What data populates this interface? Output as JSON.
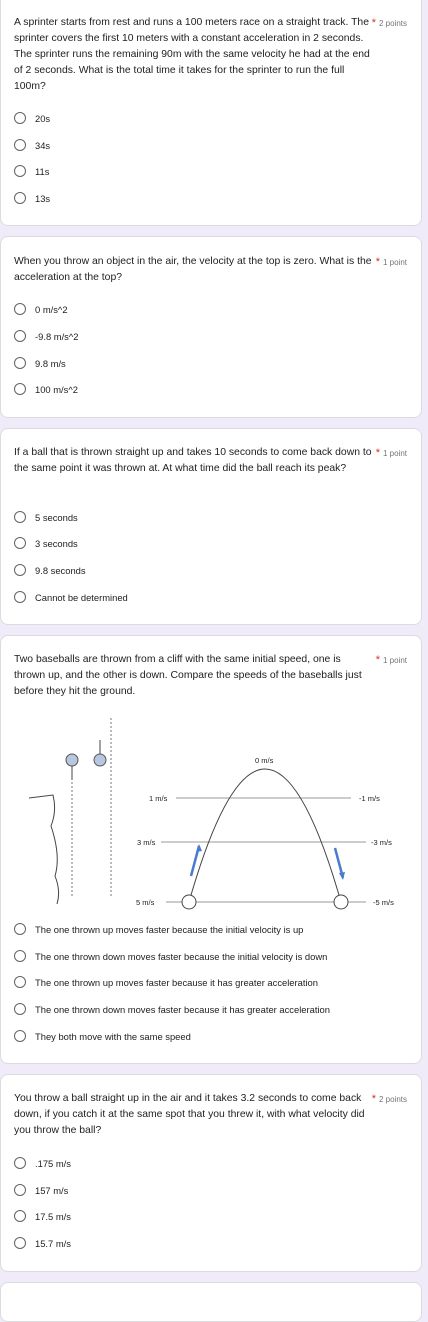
{
  "questions": [
    {
      "text": "A sprinter starts from rest and runs a 100 meters race on a straight track. The sprinter covers the first 10 meters with a constant acceleration in 2 seconds. The sprinter runs the remaining 90m with the same velocity he had at the end of 2 seconds. What is the total time it takes for the sprinter to run the full 100m?",
      "points": "2 points",
      "options": [
        "20s",
        "34s",
        "11s",
        "13s"
      ]
    },
    {
      "text": "When you throw an object in the air, the velocity at the top is zero. What is the acceleration at the top?",
      "points": "1 point",
      "options": [
        "0 m/s^2",
        "-9.8 m/s^2",
        "9.8 m/s",
        "100 m/s^2"
      ]
    },
    {
      "text": "If a ball that is thrown straight up and takes 10 seconds to come back down to the same point it was thrown at. At what time did the ball reach its peak?",
      "points": "1 point",
      "options": [
        "5 seconds",
        "3 seconds",
        "9.8 seconds",
        "Cannot be determined"
      ]
    },
    {
      "text": "Two baseballs are thrown from a cliff with the same initial speed, one is thrown up, and the other is down. Compare the speeds of the baseballs just before they hit the ground.",
      "points": "1 point",
      "figure": {
        "top_label": "0 m/s",
        "left_labels": [
          "1 m/s",
          "3 m/s",
          "5 m/s"
        ],
        "right_labels": [
          "-1 m/s",
          "-3 m/s",
          "-5 m/s"
        ]
      },
      "options": [
        "The one thrown up moves faster because the initial velocity is up",
        "The one thrown down moves faster because the initial velocity is down",
        "The one thrown up moves faster because it has greater acceleration",
        "The one thrown down moves faster because it has greater acceleration",
        "They both move with the same speed"
      ]
    },
    {
      "text": "You throw a ball straight up in the air and it takes 3.2 seconds to come back down, if you catch it at the same spot that you threw it, with what velocity did you throw the ball?",
      "points": "2 points",
      "options": [
        ".175 m/s",
        "157 m/s",
        "17.5 m/s",
        "15.7 m/s"
      ]
    }
  ]
}
